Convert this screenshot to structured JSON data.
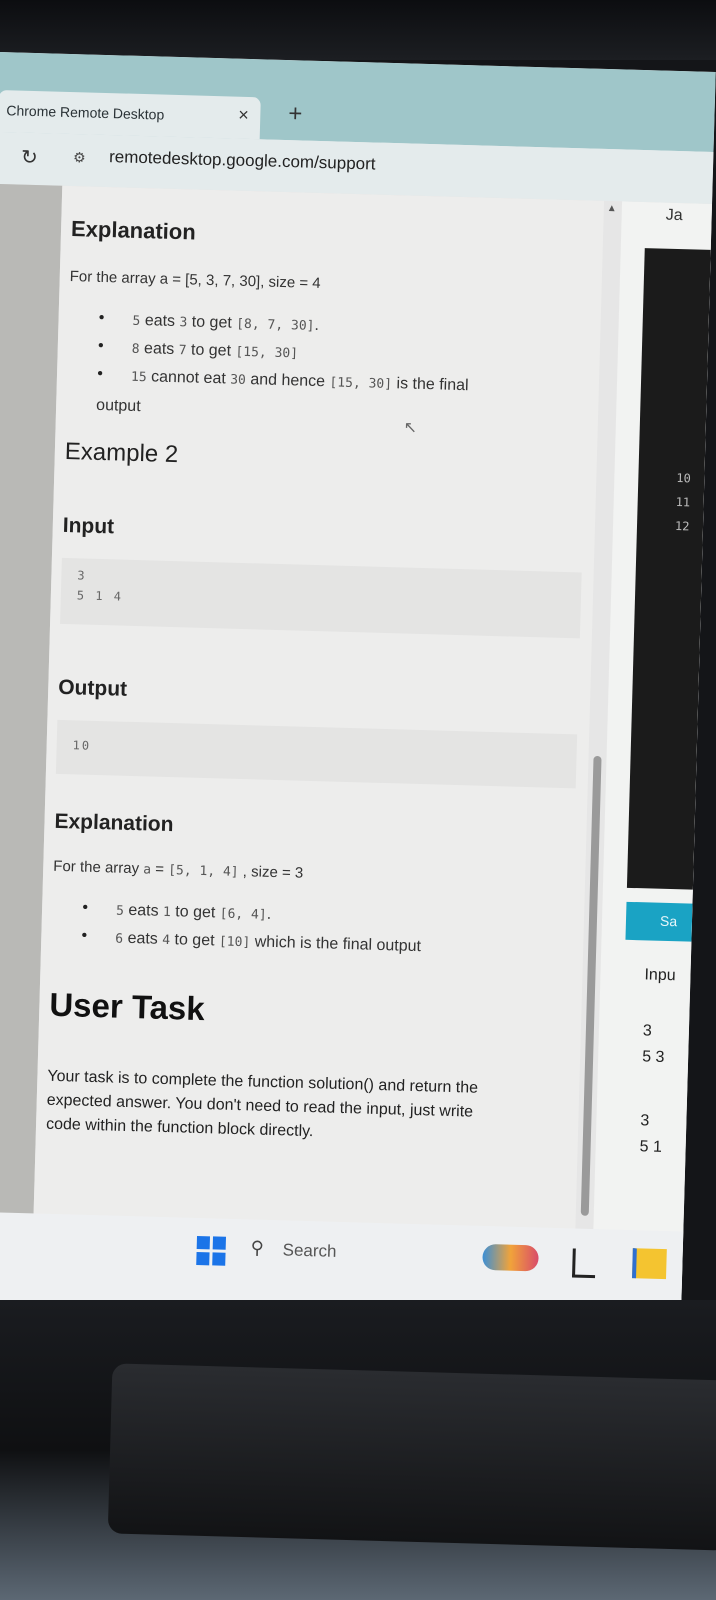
{
  "browser": {
    "tab_title": "Chrome Remote Desktop",
    "tab_close": "×",
    "new_tab": "+",
    "reload_icon": "↻",
    "site_info_icon": "⚙",
    "url": "remotedesktop.google.com/support"
  },
  "problem": {
    "explanation1": {
      "heading": "Explanation",
      "intro_prefix": "For the array a = ",
      "intro_array": "[5, 3, 7, 30]",
      "intro_suffix": ", size = 4",
      "bullets": [
        {
          "code1": "5",
          "t1": " eats ",
          "code2": "3",
          "t2": " to get ",
          "code3": "[8, 7, 30]",
          "t3": "."
        },
        {
          "code1": "8",
          "t1": " eats ",
          "code2": "7",
          "t2": " to get ",
          "code3": "[15, 30]",
          "t3": ""
        },
        {
          "code1": "15",
          "t1": " cannot eat ",
          "code2": "30",
          "t2": " and hence ",
          "code3": "[15, 30]",
          "t3": " is the final"
        }
      ],
      "bullet_wrap": "output"
    },
    "example2": {
      "heading": "Example 2",
      "input_heading": "Input",
      "input_lines": [
        "3",
        "5 1 4"
      ],
      "output_heading": "Output",
      "output_lines": [
        "10"
      ]
    },
    "explanation2": {
      "heading": "Explanation",
      "intro_prefix": "For the array ",
      "intro_a": "a",
      "intro_eq": " = ",
      "intro_array": "[5, 1, 4]",
      "intro_suffix": " , size = 3",
      "bullets": [
        {
          "code1": "5",
          "t1": " eats ",
          "code2": "1",
          "t2": " to get ",
          "code3": "[6, 4]",
          "t3": "."
        },
        {
          "code1": "6",
          "t1": " eats ",
          "code2": "4",
          "t2": " to get ",
          "code3": "[10]",
          "t3": " which is the final output"
        }
      ]
    },
    "user_task": {
      "heading": "User Task",
      "lines": [
        "Your task is to complete the function solution() and return the",
        "expected answer. You don't need to read the input, just write",
        "code within the function block directly."
      ]
    }
  },
  "right_panel": {
    "language": "Ja",
    "line_numbers": [
      "10",
      "11",
      "12"
    ],
    "save_label": "Sa",
    "input_label": "Inpu",
    "case1": [
      "3",
      "5 3"
    ],
    "case2": [
      "3",
      "5 1"
    ]
  },
  "taskbar": {
    "search_label": "Search",
    "search_icon": "⚲"
  }
}
